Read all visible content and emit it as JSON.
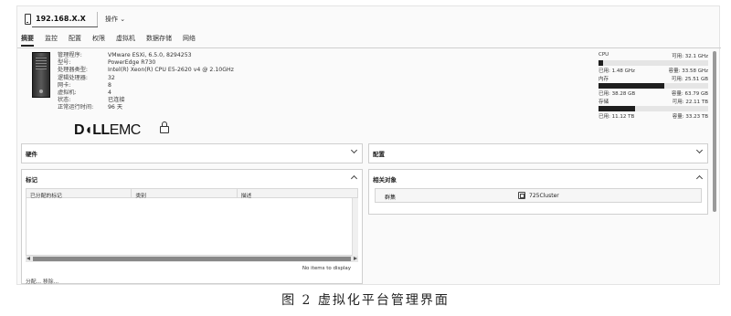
{
  "header": {
    "host_name": "192.168.X.X",
    "actions_label": "操作 ⌄"
  },
  "tabs": [
    {
      "label": "摘要",
      "active": true
    },
    {
      "label": "监控",
      "active": false
    },
    {
      "label": "配置",
      "active": false
    },
    {
      "label": "权限",
      "active": false
    },
    {
      "label": "虚拟机",
      "active": false
    },
    {
      "label": "数据存储",
      "active": false
    },
    {
      "label": "网络",
      "active": false
    }
  ],
  "summary": {
    "rows": [
      {
        "label": "管理程序:",
        "value": "VMware ESXi, 6.5.0, 8294253"
      },
      {
        "label": "型号:",
        "value": "PowerEdge R730"
      },
      {
        "label": "处理器类型:",
        "value": "Intel(R) Xeon(R) CPU E5-2620 v4 @ 2.10GHz"
      },
      {
        "label": "逻辑处理器:",
        "value": "32"
      },
      {
        "label": "网卡:",
        "value": "8"
      },
      {
        "label": "虚拟机:",
        "value": "4"
      },
      {
        "label": "状态:",
        "value": "已连接"
      },
      {
        "label": "正常运行时间:",
        "value": "96 天"
      }
    ],
    "vendor_logo_text": {
      "bold": "D◖LL",
      "light": "EMC"
    }
  },
  "resources": [
    {
      "name": "CPU",
      "free": "可用: 32.1 GHz",
      "used": "已用: 1.48 GHz",
      "capacity": "容量: 33.58 GHz",
      "used_fraction": 0.044
    },
    {
      "name": "内存",
      "free": "可用: 25.51 GB",
      "used": "已用: 38.28 GB",
      "capacity": "容量: 63.79 GB",
      "used_fraction": 0.6
    },
    {
      "name": "存储",
      "free": "可用: 22.11 TB",
      "used": "已用: 11.12 TB",
      "capacity": "容量: 33.23 TB",
      "used_fraction": 0.335
    }
  ],
  "panels": {
    "hardware": {
      "title": "硬件"
    },
    "config": {
      "title": "配置"
    },
    "tags": {
      "title": "标记",
      "columns": [
        "已分配的标记",
        "类别",
        "描述"
      ],
      "empty_text": "No items to display",
      "footer": "分配... 移除..."
    },
    "related": {
      "title": "相关对象",
      "row_key": "群集",
      "row_value": "725Cluster"
    }
  },
  "caption": "图 2  虚拟化平台管理界面"
}
